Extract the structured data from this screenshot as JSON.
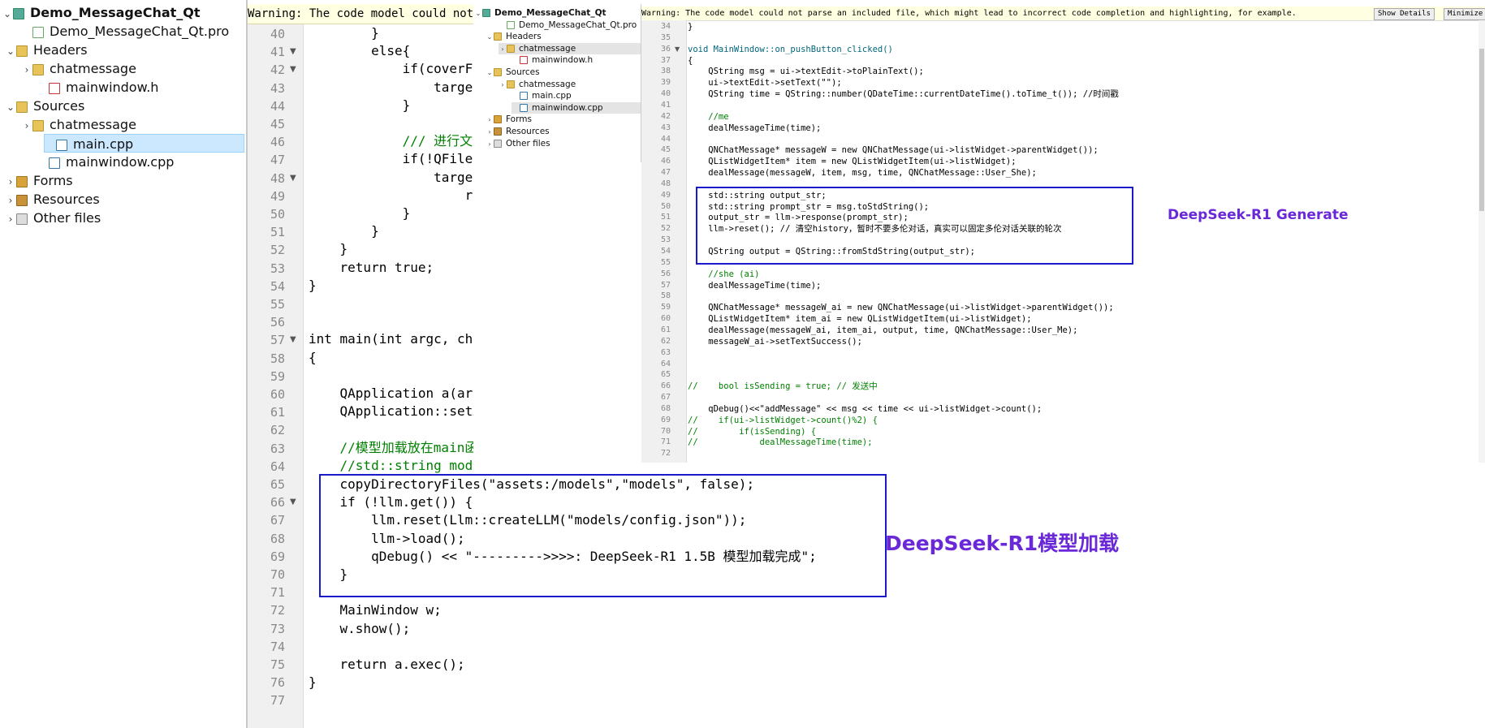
{
  "tree_large": {
    "project": "Demo_MessageChat_Qt",
    "items": [
      {
        "label": "Demo_MessageChat_Qt.pro",
        "icon": "pro-file-icon"
      },
      {
        "label": "Headers",
        "icon": "folder-icon"
      },
      {
        "label": "chatmessage",
        "icon": "folder-icon"
      },
      {
        "label": "mainwindow.h",
        "icon": "header-file-icon"
      },
      {
        "label": "Sources",
        "icon": "folder-icon"
      },
      {
        "label": "chatmessage",
        "icon": "folder-icon"
      },
      {
        "label": "main.cpp",
        "icon": "cpp-file-icon"
      },
      {
        "label": "mainwindow.cpp",
        "icon": "cpp-file-icon"
      },
      {
        "label": "Forms",
        "icon": "forms-folder-icon"
      },
      {
        "label": "Resources",
        "icon": "resources-folder-icon"
      },
      {
        "label": "Other files",
        "icon": "other-files-icon"
      }
    ]
  },
  "editor_large": {
    "warning": "Warning: The code model could not",
    "line_numbers": [
      "40",
      "41",
      "42",
      "43",
      "44",
      "45",
      "46",
      "47",
      "48",
      "49",
      "50",
      "51",
      "52",
      "53",
      "54",
      "55",
      "56",
      "57",
      "58",
      "59",
      "60",
      "61",
      "62",
      "63",
      "64",
      "65",
      "66",
      "67",
      "68",
      "69",
      "70",
      "71",
      "72",
      "73",
      "74",
      "75",
      "76",
      "77"
    ],
    "lines": [
      "        }",
      "        else{",
      "            if(coverFileIfExist)",
      "                targetDir.remove(fileInfo.fileName());",
      "            }",
      "",
      "            /// 进行文件copy",
      "            if(!QFile::copy(fileInfo.filePath(),",
      "                targetDir.filePath(fileInfo.fileName()))){",
      "                    return false;",
      "            }",
      "        }",
      "    }",
      "    return true;",
      "}",
      "",
      "",
      "int main(int argc, char *argv[])",
      "{",
      "",
      "    QApplication a(argc, argv);",
      "    QApplication::setAttribute(Qt::AA_EnableHighDpiScaling);",
      "",
      "    //模型加载放在main函数",
      "    //std::string model_dir =\"assets:/models\";",
      "    copyDirectoryFiles(\"assets:/models\",\"models\", false);",
      "    if (!llm.get()) {",
      "        llm.reset(Llm::createLLM(\"models/config.json\"));",
      "        llm->load();",
      "        qDebug() << \"--------->>>>: DeepSeek-R1 1.5B 模型加载完成\";",
      "    }",
      "",
      "    MainWindow w;",
      "    w.show();",
      "",
      "    return a.exec();",
      "}",
      ""
    ]
  },
  "tree_small": {
    "project": "Demo_MessageChat_Qt",
    "items": [
      "Demo_MessageChat_Qt.pro",
      "Headers",
      "chatmessage",
      "mainwindow.h",
      "Sources",
      "chatmessage",
      "main.cpp",
      "mainwindow.cpp",
      "Forms",
      "Resources",
      "Other files"
    ]
  },
  "editor_small": {
    "warning": "Warning: The code model could not parse an included file, which might lead to incorrect code completion and highlighting, for example.",
    "show_details": "Show Details",
    "minimize": "Minimize",
    "line_numbers": [
      "34",
      "35",
      "36",
      "37",
      "38",
      "39",
      "40",
      "41",
      "42",
      "43",
      "44",
      "45",
      "46",
      "47",
      "48",
      "49",
      "50",
      "51",
      "52",
      "53",
      "54",
      "55",
      "56",
      "57",
      "58",
      "59",
      "60",
      "61",
      "62",
      "63",
      "64",
      "65",
      "66",
      "67",
      "68",
      "69",
      "70",
      "71",
      "72"
    ],
    "lines": [
      "}",
      "",
      "void MainWindow::on_pushButton_clicked()",
      "{",
      "    QString msg = ui->textEdit->toPlainText();",
      "    ui->textEdit->setText(\"\");",
      "    QString time = QString::number(QDateTime::currentDateTime().toTime_t()); //时间戳",
      "",
      "    //me",
      "    dealMessageTime(time);",
      "",
      "    QNChatMessage* messageW = new QNChatMessage(ui->listWidget->parentWidget());",
      "    QListWidgetItem* item = new QListWidgetItem(ui->listWidget);",
      "    dealMessage(messageW, item, msg, time, QNChatMessage::User_She);",
      "",
      "    std::string output_str;",
      "    std::string prompt_str = msg.toStdString();",
      "    output_str = llm->response(prompt_str);",
      "    llm->reset(); // 清空history，暂时不要多伦对话，真实可以固定多伦对话关联的轮次",
      "",
      "    QString output = QString::fromStdString(output_str);",
      "",
      "    //she (ai)",
      "    dealMessageTime(time);",
      "",
      "    QNChatMessage* messageW_ai = new QNChatMessage(ui->listWidget->parentWidget());",
      "    QListWidgetItem* item_ai = new QListWidgetItem(ui->listWidget);",
      "    dealMessage(messageW_ai, item_ai, output, time, QNChatMessage::User_Me);",
      "    messageW_ai->setTextSuccess();",
      "",
      "",
      "",
      "//    bool isSending = true; // 发送中",
      "",
      "    qDebug()<<\"addMessage\" << msg << time << ui->listWidget->count();",
      "//    if(ui->listWidget->count()%2) {",
      "//        if(isSending) {",
      "//            dealMessageTime(time);",
      ""
    ]
  },
  "annotations": {
    "generate": "DeepSeek-R1 Generate",
    "load": "DeepSeek-R1模型加载"
  },
  "colors": {
    "box": "#1a1acc",
    "annotation": "#6a28d8",
    "selection": "#cce8ff"
  }
}
